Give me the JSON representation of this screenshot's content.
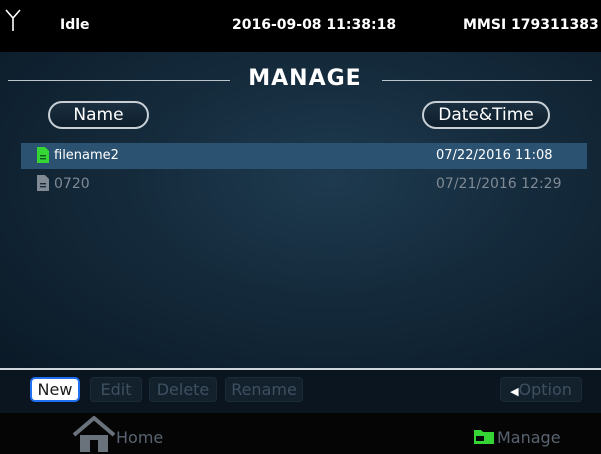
{
  "status": {
    "state": "Idle",
    "datetime": "2016-09-08 11:38:18",
    "mmsi": "MMSI 179311383"
  },
  "page_title": "MANAGE",
  "columns": {
    "name": "Name",
    "datetime": "Date&Time"
  },
  "files": [
    {
      "name": "filename2",
      "datetime": "07/22/2016 11:08",
      "selected": true,
      "icon": "document-icon-green"
    },
    {
      "name": "0720",
      "datetime": "07/21/2016 12:29",
      "selected": false,
      "icon": "document-icon-gray"
    }
  ],
  "toolbar": {
    "new_label": "New",
    "edit_label": "Edit",
    "delete_label": "Delete",
    "rename_label": "Rename",
    "option_label": "Option"
  },
  "nav": {
    "home_label": "Home",
    "manage_label": "Manage"
  },
  "colors": {
    "accent_blue": "#1f6ff0",
    "selected_row": "#2c5271",
    "file_green": "#34d534"
  }
}
